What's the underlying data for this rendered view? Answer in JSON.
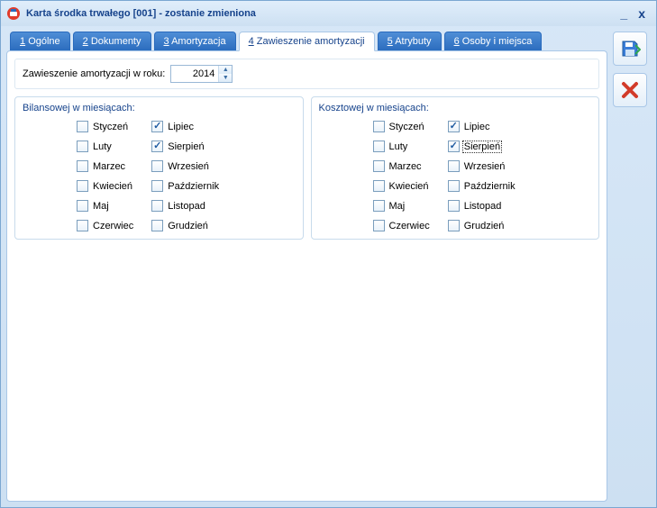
{
  "window": {
    "title": "Karta środka trwałego [001] - zostanie zmieniona"
  },
  "tabs": {
    "t1": {
      "num": "1",
      "label": "Ogólne"
    },
    "t2": {
      "num": "2",
      "label": "Dokumenty"
    },
    "t3": {
      "num": "3",
      "label": "Amortyzacja"
    },
    "t4": {
      "num": "4",
      "label": "Zawieszenie amortyzacji"
    },
    "t5": {
      "num": "5",
      "label": "Atrybuty"
    },
    "t6": {
      "num": "6",
      "label": "Osoby i miejsca"
    }
  },
  "year": {
    "label": "Zawieszenie amortyzacji w roku:",
    "value": "2014"
  },
  "groups": {
    "bilans": {
      "title": "Bilansowej w miesiącach:"
    },
    "koszt": {
      "title": "Kosztowej w miesiącach:"
    }
  },
  "months": {
    "m1": "Styczeń",
    "m2": "Luty",
    "m3": "Marzec",
    "m4": "Kwiecień",
    "m5": "Maj",
    "m6": "Czerwiec",
    "m7": "Lipiec",
    "m8": "Sierpień",
    "m9": "Wrzesień",
    "m10": "Październik",
    "m11": "Listopad",
    "m12": "Grudzień"
  },
  "checked": {
    "bilans": {
      "m7": true,
      "m8": true
    },
    "koszt": {
      "m7": true,
      "m8": true
    }
  }
}
